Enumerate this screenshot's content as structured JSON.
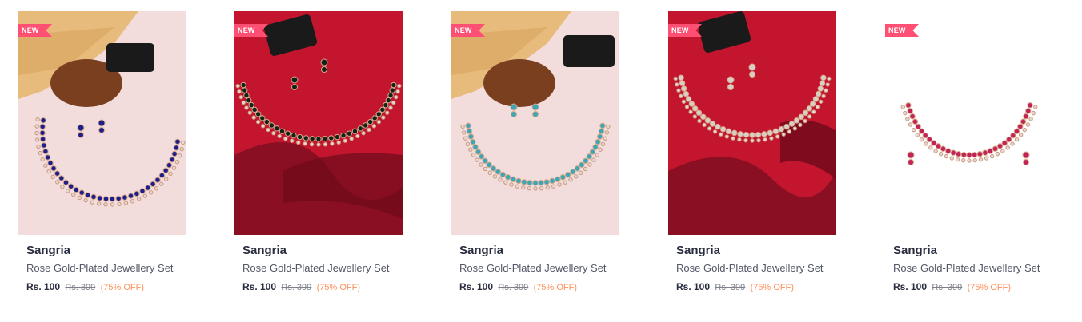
{
  "products": [
    {
      "badge": "NEW",
      "brand": "Sangria",
      "title": "Rose Gold-Plated Jewellery Set",
      "price": "Rs. 100",
      "mrp": "Rs. 399",
      "discount": "(75% OFF)",
      "stone_color": "#1d1f8a",
      "background": "#f3dcdc"
    },
    {
      "badge": "NEW",
      "brand": "Sangria",
      "title": "Rose Gold-Plated Jewellery Set",
      "price": "Rs. 100",
      "mrp": "Rs. 399",
      "discount": "(75% OFF)",
      "stone_color": "#0f2418",
      "background": "#c4152f"
    },
    {
      "badge": "NEW",
      "brand": "Sangria",
      "title": "Rose Gold-Plated Jewellery Set",
      "price": "Rs. 100",
      "mrp": "Rs. 399",
      "discount": "(75% OFF)",
      "stone_color": "#3aa7b8",
      "background": "#f3dcdc"
    },
    {
      "badge": "NEW",
      "brand": "Sangria",
      "title": "Rose Gold-Plated Jewellery Set",
      "price": "Rs. 100",
      "mrp": "Rs. 399",
      "discount": "(75% OFF)",
      "stone_color": "#d8d0c8",
      "background": "#c4152f"
    },
    {
      "badge": "NEW",
      "brand": "Sangria",
      "title": "Rose Gold-Plated Jewellery Set",
      "price": "Rs. 100",
      "mrp": "Rs. 399",
      "discount": "(75% OFF)",
      "stone_color": "#c2245a",
      "background": "#ffffff"
    }
  ]
}
